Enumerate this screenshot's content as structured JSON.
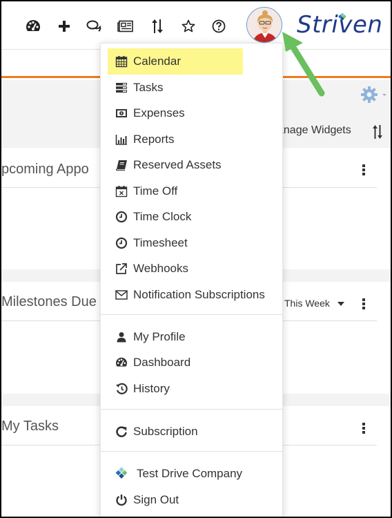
{
  "header": {
    "icons": [
      {
        "name": "dashboard-icon"
      },
      {
        "name": "plus-icon"
      },
      {
        "name": "chat-icon"
      },
      {
        "name": "newspaper-icon"
      },
      {
        "name": "sort-icon"
      },
      {
        "name": "star-icon"
      },
      {
        "name": "help-icon"
      }
    ],
    "logo_text": "Striven"
  },
  "toolbar": {
    "manage_widgets_label": "anage Widgets"
  },
  "widgets": [
    {
      "title": "pcoming Appo"
    },
    {
      "title": "Milestones Due",
      "filter": "This Week"
    },
    {
      "title": "My Tasks"
    }
  ],
  "user_menu": {
    "section1": [
      {
        "label": "Calendar",
        "icon": "calendar-icon",
        "highlighted": true
      },
      {
        "label": "Tasks",
        "icon": "tasks-icon"
      },
      {
        "label": "Expenses",
        "icon": "money-icon"
      },
      {
        "label": "Reports",
        "icon": "bar-chart-icon"
      },
      {
        "label": "Reserved Assets",
        "icon": "book-icon"
      },
      {
        "label": "Time Off",
        "icon": "calendar-x-icon"
      },
      {
        "label": "Time Clock",
        "icon": "clock-icon"
      },
      {
        "label": "Timesheet",
        "icon": "clock-icon"
      },
      {
        "label": "Webhooks",
        "icon": "external-link-icon"
      },
      {
        "label": "Notification Subscriptions",
        "icon": "envelope-icon"
      }
    ],
    "section2": [
      {
        "label": "My Profile",
        "icon": "user-icon"
      },
      {
        "label": "Dashboard",
        "icon": "dashboard-icon"
      },
      {
        "label": "History",
        "icon": "history-icon"
      }
    ],
    "section3": [
      {
        "label": "Subscription",
        "icon": "refresh-icon"
      }
    ],
    "section4": [
      {
        "label": "Test Drive Company",
        "icon": "company-logo-icon"
      },
      {
        "label": "Sign Out",
        "icon": "power-icon"
      }
    ]
  },
  "colors": {
    "accent_orange": "#f07a1a",
    "highlight_yellow": "#fdf78e",
    "annotation_arrow": "#6abf5e",
    "logo_blue": "#1f3a8a"
  }
}
